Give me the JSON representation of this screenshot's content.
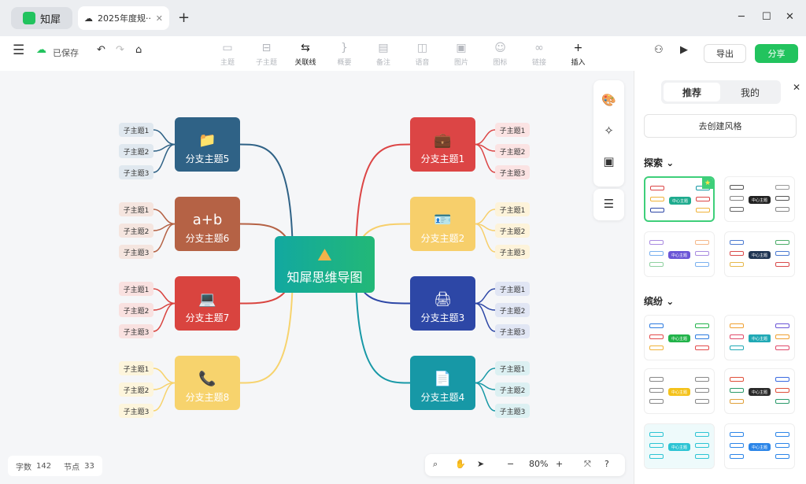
{
  "app": {
    "name": "知犀",
    "tab_title": "2025年度规···",
    "new_tab": "+"
  },
  "window": {
    "minimize": "─",
    "maximize": "☐",
    "close": "✕"
  },
  "toolbar": {
    "saved": "已保存",
    "tools": [
      {
        "label": "主题",
        "icon": "▭",
        "active": false
      },
      {
        "label": "子主题",
        "icon": "⊟",
        "active": false
      },
      {
        "label": "关联线",
        "icon": "⇆",
        "active": true
      },
      {
        "label": "概要",
        "icon": "}",
        "active": false
      },
      {
        "label": "备注",
        "icon": "▤",
        "active": false
      },
      {
        "label": "语音",
        "icon": "◫",
        "active": false
      },
      {
        "label": "图片",
        "icon": "▣",
        "active": false
      },
      {
        "label": "图标",
        "icon": "☺",
        "active": false
      },
      {
        "label": "链接",
        "icon": "∞",
        "active": false
      },
      {
        "label": "插入",
        "icon": "+",
        "active": true
      }
    ],
    "export": "导出",
    "share": "分享"
  },
  "mindmap": {
    "center": {
      "label": "知犀思维导图",
      "icon": "mountain-flag-icon",
      "icon_glyph": "⛰"
    },
    "branches": [
      {
        "label": "分支主题1",
        "color": "#dc4545",
        "sub_bg": "#fbe3e3",
        "icon": "briefcase-icon",
        "glyph": "💼",
        "children": [
          "子主题1",
          "子主题2",
          "子主题3"
        ]
      },
      {
        "label": "分支主题2",
        "color": "#f7cf6b",
        "sub_bg": "#fdf3da",
        "icon": "id-badge-icon",
        "glyph": "🪪",
        "children": [
          "子主题1",
          "子主题2",
          "子主题3"
        ]
      },
      {
        "label": "分支主题3",
        "color": "#2d47a6",
        "sub_bg": "#e1e6f4",
        "icon": "printer-icon",
        "glyph": "🖨",
        "children": [
          "子主题1",
          "子主题2",
          "子主题3"
        ]
      },
      {
        "label": "分支主题4",
        "color": "#1798a6",
        "sub_bg": "#dcf0f2",
        "icon": "document-icon",
        "glyph": "📄",
        "children": [
          "子主题1",
          "子主题2",
          "子主题3"
        ]
      },
      {
        "label": "分支主题5",
        "color": "#2f6286",
        "sub_bg": "#e0e8ef",
        "icon": "folder-icon",
        "glyph": "📁",
        "children": [
          "子主题1",
          "子主题2",
          "子主题3"
        ]
      },
      {
        "label": "分支主题6",
        "color": "#b56245",
        "sub_bg": "#f5e5df",
        "icon": "blackboard-icon",
        "glyph": "a+b",
        "children": [
          "子主题1",
          "子主题2",
          "子主题3"
        ]
      },
      {
        "label": "分支主题7",
        "color": "#d9443f",
        "sub_bg": "#f9e1e0",
        "icon": "laptop-icon",
        "glyph": "💻",
        "children": [
          "子主题1",
          "子主题2",
          "子主题3"
        ]
      },
      {
        "label": "分支主题8",
        "color": "#f7d36d",
        "sub_bg": "#fdf5dc",
        "icon": "phone-icon",
        "glyph": "📞",
        "children": [
          "子主题1",
          "子主题2",
          "子主题3"
        ]
      }
    ]
  },
  "status": {
    "words_label": "字数",
    "words": "142",
    "nodes_label": "节点",
    "nodes": "33"
  },
  "zoom": {
    "level": "80%",
    "minus": "−",
    "plus": "+"
  },
  "panel": {
    "tabs": [
      "推荐",
      "我的"
    ],
    "create": "去创建风格",
    "explore": "探索",
    "colorful": "缤纷",
    "center_label": "中心主题",
    "sub_label": "分支主题"
  }
}
